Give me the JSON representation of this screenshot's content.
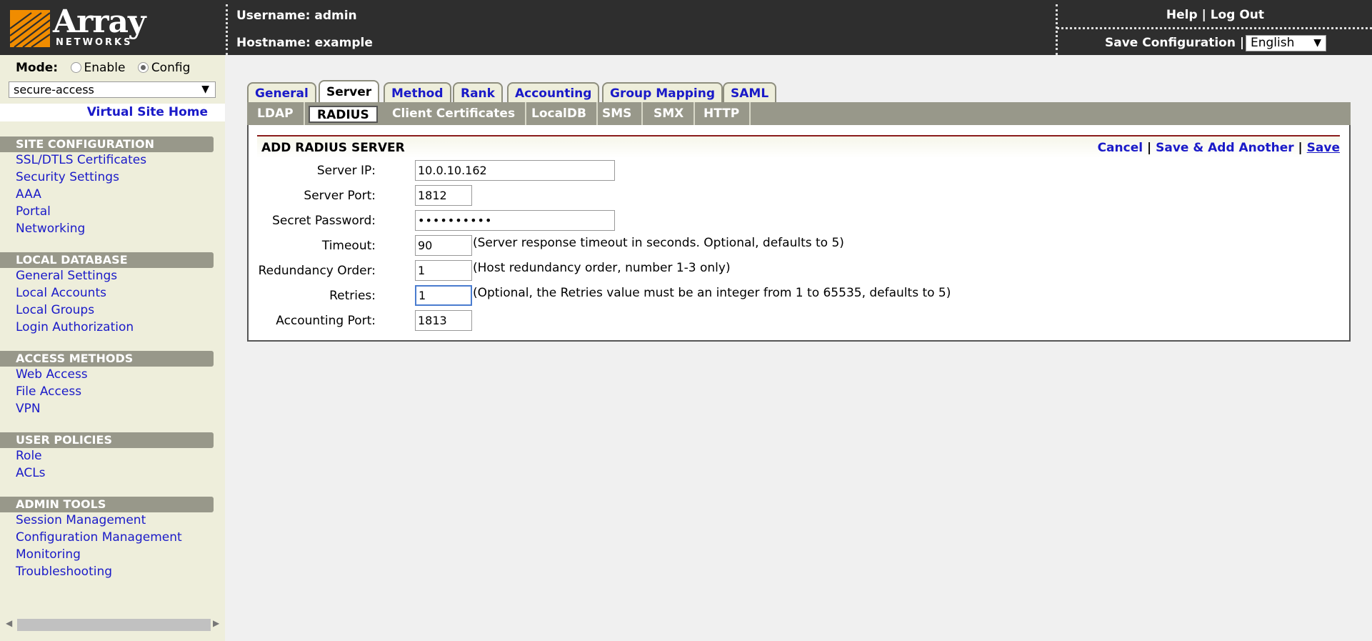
{
  "header": {
    "logo_word": "Array",
    "logo_sub": "NETWORKS",
    "username": "Username: admin",
    "hostname": "Hostname: example",
    "help": "Help",
    "separator": "|",
    "logout": "Log Out",
    "save_configuration": "Save Configuration",
    "language": "English"
  },
  "sidebar": {
    "mode_label": "Mode:",
    "mode_enable": "Enable",
    "mode_config": "Config",
    "site": "secure-access",
    "virtual_site_home": "Virtual Site Home",
    "sections": [
      {
        "title": "SITE CONFIGURATION",
        "items": [
          "SSL/DTLS Certificates",
          "Security Settings",
          "AAA",
          "Portal",
          "Networking"
        ]
      },
      {
        "title": "LOCAL DATABASE",
        "items": [
          "General Settings",
          "Local Accounts",
          "Local Groups",
          "Login Authorization"
        ]
      },
      {
        "title": "ACCESS METHODS",
        "items": [
          "Web Access",
          "File Access",
          "VPN"
        ]
      },
      {
        "title": "USER POLICIES",
        "items": [
          "Role",
          "ACLs"
        ]
      },
      {
        "title": "ADMIN TOOLS",
        "items": [
          "Session Management",
          "Configuration Management",
          "Monitoring",
          "Troubleshooting"
        ]
      }
    ]
  },
  "tabs": [
    "General",
    "Server",
    "Method",
    "Rank",
    "Accounting",
    "Group Mapping",
    "SAML"
  ],
  "subtabs": [
    "LDAP",
    "RADIUS",
    "Client Certificates",
    "LocalDB",
    "SMS",
    "SMX",
    "HTTP"
  ],
  "form": {
    "title": "ADD RADIUS SERVER",
    "cancel": "Cancel",
    "save_add_another": "Save & Add Another",
    "save": "Save",
    "separator": "|",
    "fields": {
      "server_ip": {
        "label": "Server IP:",
        "value": "10.0.10.162"
      },
      "server_port": {
        "label": "Server Port:",
        "value": "1812"
      },
      "secret_password": {
        "label": "Secret Password:",
        "value": "••••••••••"
      },
      "timeout": {
        "label": "Timeout:",
        "value": "90",
        "hint": "(Server response timeout in seconds. Optional, defaults to 5)"
      },
      "redundancy_order": {
        "label": "Redundancy Order:",
        "value": "1",
        "hint": "(Host redundancy order, number 1-3 only)"
      },
      "retries": {
        "label": "Retries:",
        "value": "1",
        "hint": "(Optional, the Retries value must be an integer from 1 to 65535, defaults to 5)"
      },
      "accounting_port": {
        "label": "Accounting Port:",
        "value": "1813"
      }
    }
  },
  "colors": {
    "header_bg": "#2e2e2e",
    "sidebar_bg": "#eeeedb",
    "section_bg": "#98988a",
    "link": "#1a1ac8",
    "logo_orange": "#f08c00",
    "form_rule": "#8b1c1c"
  }
}
